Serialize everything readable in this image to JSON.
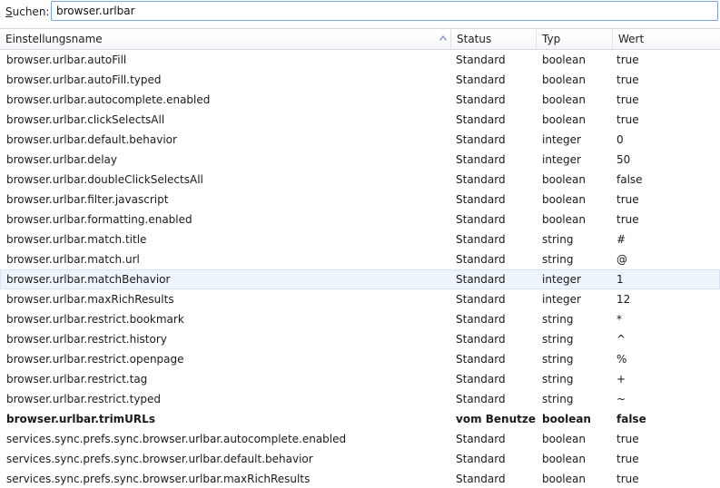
{
  "search": {
    "label_accel": "S",
    "label_rest": "uchen:",
    "value": "browser.urlbar"
  },
  "columns": {
    "name": "Einstellungsname",
    "status": "Status",
    "type": "Typ",
    "value": "Wert"
  },
  "rows": [
    {
      "name": "browser.urlbar.autoFill",
      "status": "Standard",
      "type": "boolean",
      "value": "true"
    },
    {
      "name": "browser.urlbar.autoFill.typed",
      "status": "Standard",
      "type": "boolean",
      "value": "true"
    },
    {
      "name": "browser.urlbar.autocomplete.enabled",
      "status": "Standard",
      "type": "boolean",
      "value": "true"
    },
    {
      "name": "browser.urlbar.clickSelectsAll",
      "status": "Standard",
      "type": "boolean",
      "value": "true"
    },
    {
      "name": "browser.urlbar.default.behavior",
      "status": "Standard",
      "type": "integer",
      "value": "0"
    },
    {
      "name": "browser.urlbar.delay",
      "status": "Standard",
      "type": "integer",
      "value": "50"
    },
    {
      "name": "browser.urlbar.doubleClickSelectsAll",
      "status": "Standard",
      "type": "boolean",
      "value": "false"
    },
    {
      "name": "browser.urlbar.filter.javascript",
      "status": "Standard",
      "type": "boolean",
      "value": "true"
    },
    {
      "name": "browser.urlbar.formatting.enabled",
      "status": "Standard",
      "type": "boolean",
      "value": "true"
    },
    {
      "name": "browser.urlbar.match.title",
      "status": "Standard",
      "type": "string",
      "value": "#"
    },
    {
      "name": "browser.urlbar.match.url",
      "status": "Standard",
      "type": "string",
      "value": "@"
    },
    {
      "name": "browser.urlbar.matchBehavior",
      "status": "Standard",
      "type": "integer",
      "value": "1",
      "selected": true
    },
    {
      "name": "browser.urlbar.maxRichResults",
      "status": "Standard",
      "type": "integer",
      "value": "12"
    },
    {
      "name": "browser.urlbar.restrict.bookmark",
      "status": "Standard",
      "type": "string",
      "value": "*"
    },
    {
      "name": "browser.urlbar.restrict.history",
      "status": "Standard",
      "type": "string",
      "value": "^"
    },
    {
      "name": "browser.urlbar.restrict.openpage",
      "status": "Standard",
      "type": "string",
      "value": "%"
    },
    {
      "name": "browser.urlbar.restrict.tag",
      "status": "Standard",
      "type": "string",
      "value": "+"
    },
    {
      "name": "browser.urlbar.restrict.typed",
      "status": "Standard",
      "type": "string",
      "value": "~"
    },
    {
      "name": "browser.urlbar.trimURLs",
      "status": "vom Benutze...",
      "type": "boolean",
      "value": "false",
      "modified": true
    },
    {
      "name": "services.sync.prefs.sync.browser.urlbar.autocomplete.enabled",
      "status": "Standard",
      "type": "boolean",
      "value": "true"
    },
    {
      "name": "services.sync.prefs.sync.browser.urlbar.default.behavior",
      "status": "Standard",
      "type": "boolean",
      "value": "true"
    },
    {
      "name": "services.sync.prefs.sync.browser.urlbar.maxRichResults",
      "status": "Standard",
      "type": "boolean",
      "value": "true"
    }
  ]
}
